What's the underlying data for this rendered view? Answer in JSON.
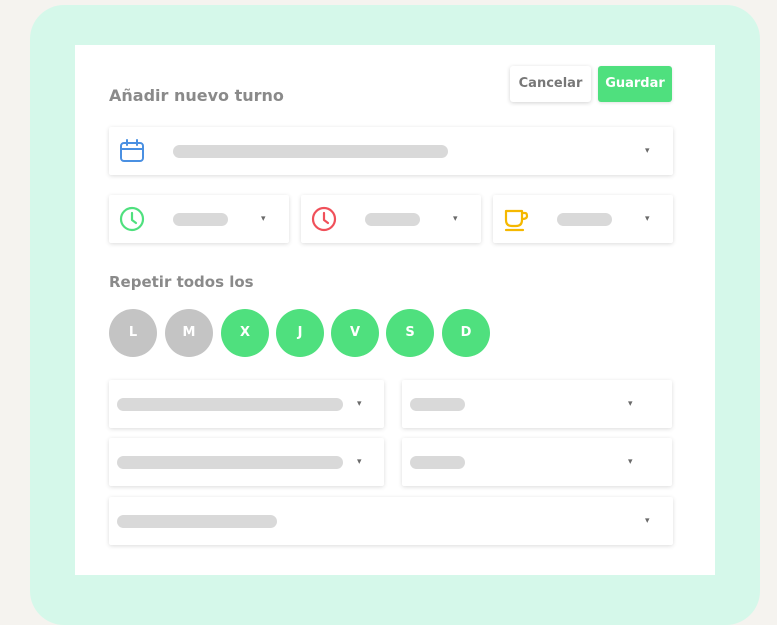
{
  "form": {
    "title": "Añadir nuevo turno",
    "cancel_label": "Cancelar",
    "save_label": "Guardar",
    "repeat_label": "Repetir todos los"
  },
  "fields": {
    "date_icon": "calendar-icon",
    "start_icon": "clock-icon",
    "end_icon": "clock-icon",
    "break_icon": "coffee-cup-icon",
    "caret": "▾"
  },
  "days": [
    {
      "label": "L",
      "selected": false
    },
    {
      "label": "M",
      "selected": false
    },
    {
      "label": "X",
      "selected": true
    },
    {
      "label": "J",
      "selected": true
    },
    {
      "label": "V",
      "selected": true
    },
    {
      "label": "S",
      "selected": true
    },
    {
      "label": "D",
      "selected": true
    }
  ],
  "colors": {
    "accent_green": "#4fe07e",
    "day_off": "#c4c4c4",
    "calendar_icon": "#4a90e2",
    "start_clock": "#4fe07e",
    "end_clock": "#f0505a",
    "coffee": "#f5b800",
    "frame": "#d5f8ea"
  }
}
